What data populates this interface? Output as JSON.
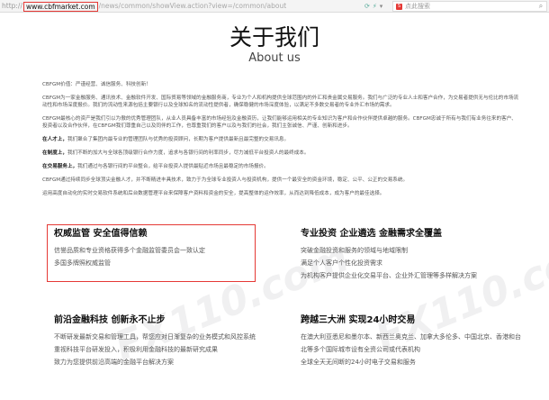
{
  "browser": {
    "url_scheme": "http://",
    "url_domain": "www.cbfmarket.com",
    "url_path": "/news/common/showView.action?view=/common/about",
    "search_placeholder": "点此搜索"
  },
  "page": {
    "title_zh": "关于我们",
    "title_en": "About us"
  },
  "paragraphs": [
    {
      "bold": "",
      "text": "CBFGM价值：严谨经营、诚信服务、科技创新！"
    },
    {
      "bold": "",
      "text": "CBFGM为一家金融服务、通讯技术、金融软件开发、国际贸易等领域的金融服务商，专业为个人和机构提供全球范围内的外汇和贵金属交易服务。我们与广泛的专业人士和客户合作，为交易者提供无与伦比的市场流动性和市场深度报价。我们的流动性来源包括主要银行以及全球知名的流动性提供者，确保稳健的市场深度体验，以满足不多数交易者的专业外汇市场的需求。"
    },
    {
      "bold": "",
      "text": "CBFGM最核心的资产是我们引以为傲的优秀管理团队，从业人员具备丰富的市场经验及金融资历，让我们能够运用相关的专业知识为客户和合作伙伴提供卓越的服务。CBFGM忠诚于所有与我们有业务往来的客户、投资者以及合作伙伴，在CBFGM我们尊重自己以及同伴的工作，也尊重我们的客户以及与我们的社会，我们主张诚信、严谨、创新和进步。"
    },
    {
      "bold": "在人才上，",
      "text": "我们聚合了集团内最专业的管理团队与优秀的投资顾问，长期为客户提供最新且最完整的交易讯息。"
    },
    {
      "bold": "在制度上，",
      "text": "我们不断的加大与全球各顶级银行合作力度，追求与各银行间的利率同步，尽力减低平台投资人的最终成本。"
    },
    {
      "bold": "在交易服务上，",
      "text": "我们通过与各银行间的平台整合，给平台投资人提供最贴近市场且最稳定的市场报价。"
    },
    {
      "bold": "",
      "text": "CBFGM通过持续同步全球顶尖金融人才，并不断精进丰具技术，致力于为全球专业投资人与投资机构，提供一个最安全的资金环境，稳定、公平、公正的交易系统。"
    },
    {
      "bold": "",
      "text": "运用高度自动化的实时交易软件系统和后台数据管理平台来保障客户资料和资金的安全，提高整体的运作效率，从而达到降低成本，成为客户的最佳选择。"
    }
  ],
  "features": [
    {
      "title": "权威监管 安全值得信赖",
      "lines": [
        "信誉品质和专业资格获得多个金融监管委员会一致认定",
        "多国多牌照权威监管"
      ]
    },
    {
      "title": "专业投资 企业遴选 金融需求全覆盖",
      "lines": [
        "突破金融投资和服务的领域与地域限制",
        "满足个人客户个性化投资需求",
        "为机构客户提供企业化交易平台、企业外汇管理等多样解决方案"
      ]
    },
    {
      "title": "前沿金融科技 创新永不止步",
      "lines": [
        "不断研发最新交易和管理工具，帮您应对日渐复杂的业务模式和风控系统",
        "重视科技平台研发投入，积极利用金融科技的最新研究成果",
        "致力为您提供前沿高端的金融平台解决方案"
      ]
    },
    {
      "title": "跨越三大洲 实现24小时交易",
      "lines": [
        "在澳大利亚悉尼和墨尔本、新西兰奥克兰、加拿大多伦多、中国北京、香港和台北等多个国际城市设有全资公司或代表机构",
        "全球全天无间断的24小时电子交易和服务"
      ]
    }
  ],
  "watermark": "FX110.com",
  "colors": {
    "highlight": "#e53935",
    "title": "#111111",
    "text": "#555555"
  }
}
